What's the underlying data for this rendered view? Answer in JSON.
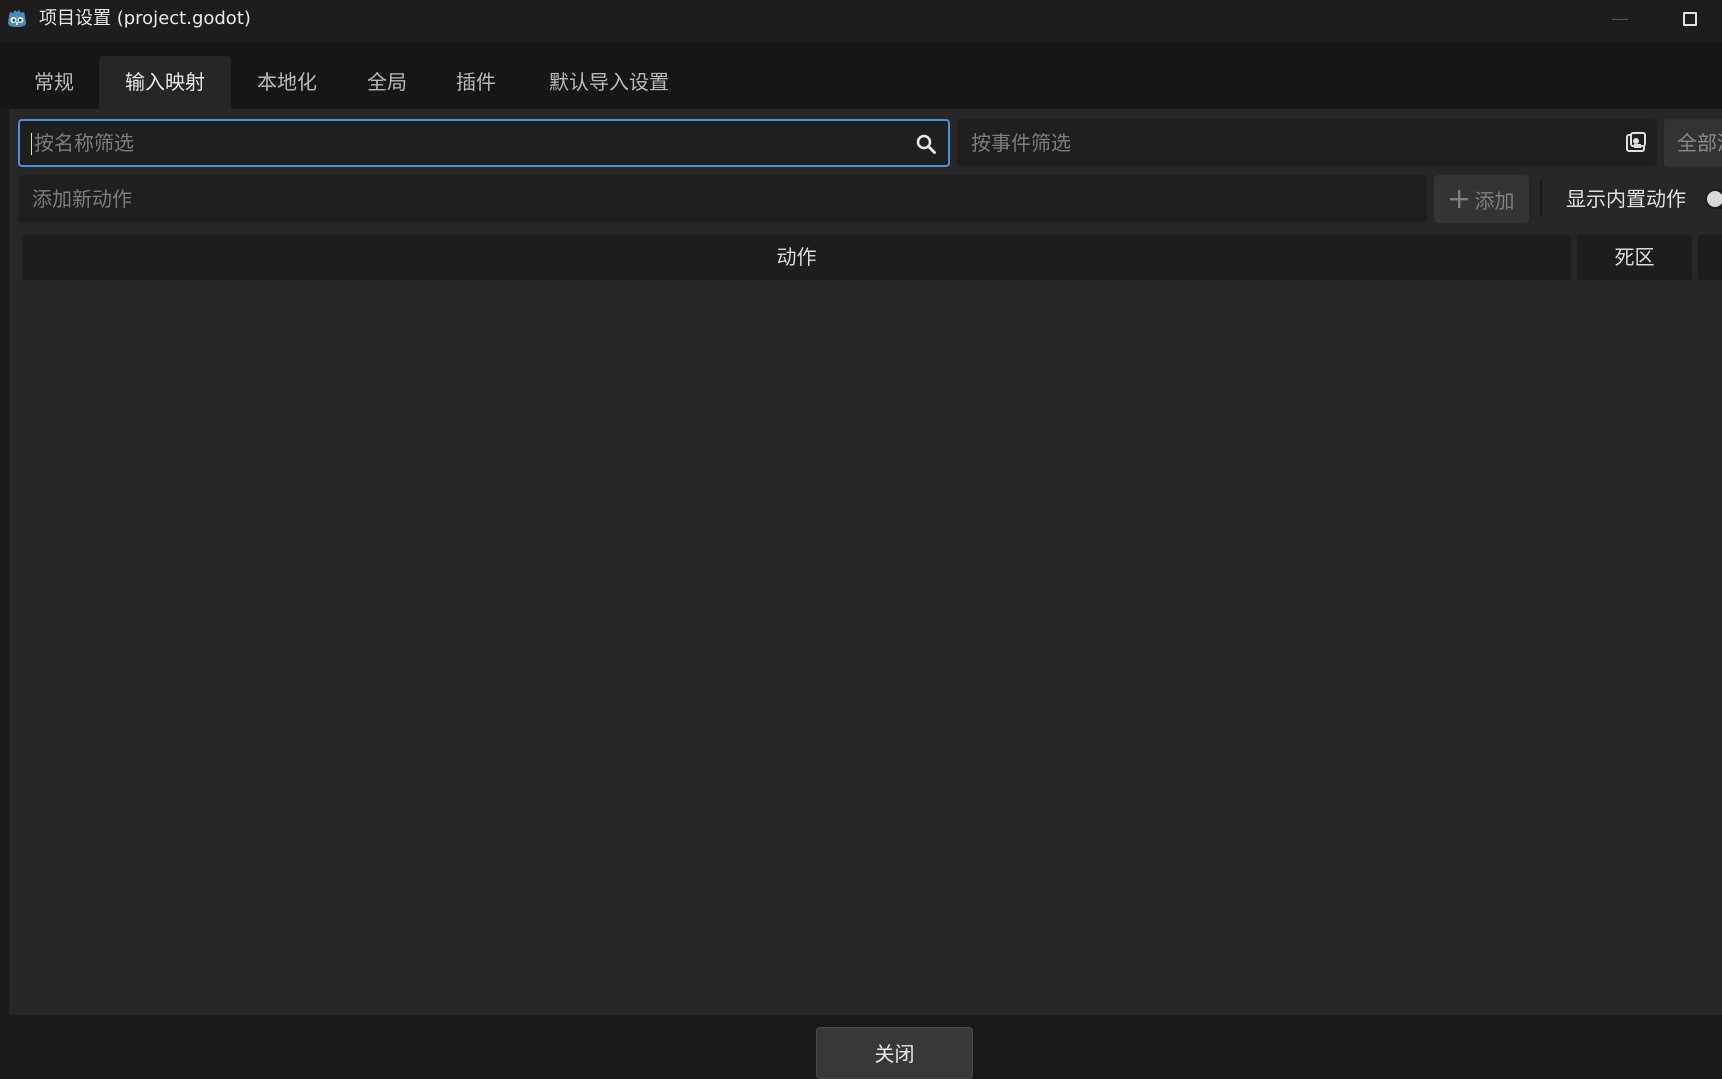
{
  "window": {
    "title": "项目设置 (project.godot)"
  },
  "tabs": [
    {
      "label": "常规"
    },
    {
      "label": "输入映射",
      "active": true
    },
    {
      "label": "本地化"
    },
    {
      "label": "全局"
    },
    {
      "label": "插件"
    },
    {
      "label": "默认导入设置"
    }
  ],
  "filters": {
    "name_placeholder": "按名称筛选",
    "name_value": "",
    "event_placeholder": "按事件筛选",
    "event_value": "",
    "clear_all_label": "全部清除"
  },
  "actions": {
    "add_placeholder": "添加新动作",
    "add_value": "",
    "add_button_label": "添加",
    "show_builtin_label": "显示内置动作",
    "show_builtin_enabled": false
  },
  "table": {
    "columns": [
      "动作",
      "死区"
    ],
    "rows": []
  },
  "footer": {
    "close_label": "关闭"
  },
  "colors": {
    "accent": "#4d8fd6",
    "panel": "#272727",
    "background": "#191919"
  }
}
